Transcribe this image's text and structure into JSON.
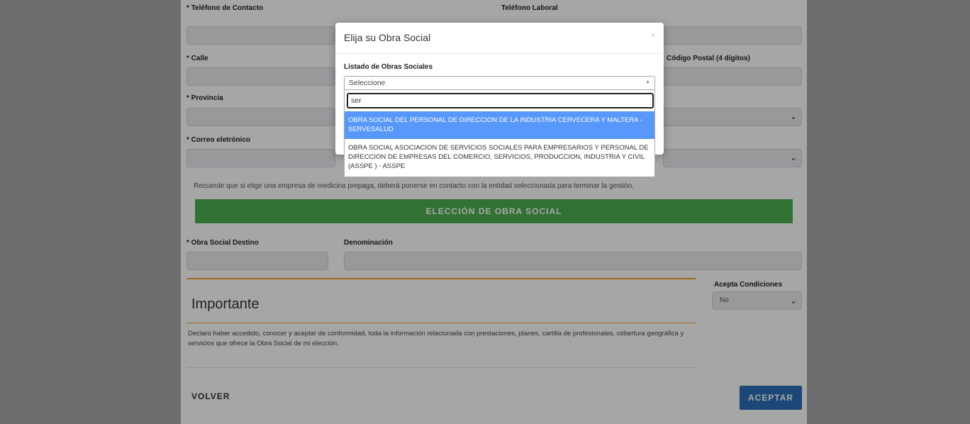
{
  "form": {
    "telefono_contacto_label": "* Teléfono de Contacto",
    "telefono_laboral_label": "Teléfono Laboral",
    "calle_label": "* Calle",
    "codigo_postal_label": "Código Postal (4 dígitos)",
    "provincia_label": "* Provincia",
    "correo_label": "* Correo eletrónico",
    "note": "Recuerde que si elige una empresa de medicina prepaga, deberá ponerse en contacto con la entidad seleccionada para terminar la gestión.",
    "eleccion_button": "ELECCIÓN DE OBRA SOCIAL",
    "obra_social_destino_label": "* Obra Social Destino",
    "denominacion_label": "Denominación",
    "acepta_condiciones_label": "Acepta Condiciones",
    "acepta_condiciones_value": "No",
    "importante_title": "Importante",
    "declaro_text": "Declaro haber accedido, conocer y aceptar de conformidad, toda la información relacionada con prestaciones, planes, cartilla de profesionales, cobertura geográfica y servicios que ofrece la Obra Social de mi elección.",
    "volver_button": "VOLVER",
    "aceptar_button": "ACEPTAR"
  },
  "modal": {
    "title": "Elija su Obra Social",
    "close": "×",
    "listado_label": "Listado de Obras Sociales",
    "select_value": "Seleccione",
    "search_value": "ser",
    "options": [
      "OBRA SOCIAL DEL PERSONAL DE DIRECCION DE LA INDUSTRIA CERVECERA Y MALTERA - SERVESALUD",
      "OBRA SOCIAL ASOCIACION DE SERVICIOS SOCIALES PARA EMPRESARIOS Y PERSONAL DE DIRECCION DE EMPRESAS DEL COMERCIO, SERVICIOS, PRODUCCION, INDUSTRIA Y CIVIL (ASSPE ) - ASSPE"
    ]
  },
  "colors": {
    "accent_green": "#4caf50",
    "accent_blue": "#2c6fb7",
    "highlight": "#5897fb",
    "orange": "#f0a030"
  }
}
